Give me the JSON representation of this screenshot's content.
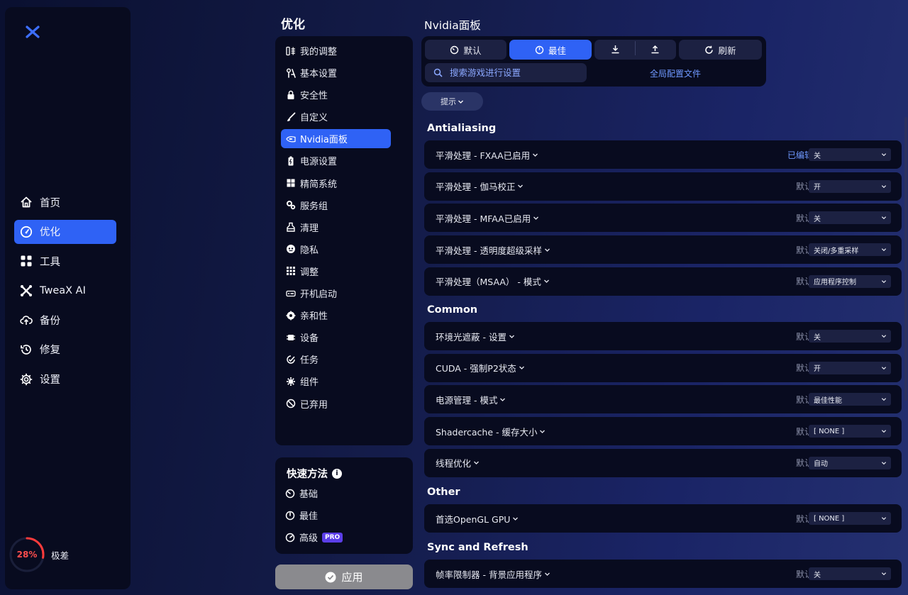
{
  "nav": {
    "items": [
      {
        "label": "首页",
        "icon": "home-icon",
        "active": false
      },
      {
        "label": "优化",
        "icon": "gauge-icon",
        "active": true
      },
      {
        "label": "工具",
        "icon": "grid-icon",
        "active": false
      },
      {
        "label": "TweaX AI",
        "icon": "ai-icon",
        "active": false
      },
      {
        "label": "备份",
        "icon": "cloud-upload-icon",
        "active": false
      },
      {
        "label": "修复",
        "icon": "history-icon",
        "active": false
      },
      {
        "label": "设置",
        "icon": "gear-icon",
        "active": false
      }
    ]
  },
  "performance": {
    "value": 28,
    "text": "28%",
    "label": "极差",
    "color": "#ff4d4d"
  },
  "section": {
    "title": "优化"
  },
  "menu": {
    "items": [
      {
        "label": "我的调整",
        "icon": "my-tweaks-icon"
      },
      {
        "label": "基本设置",
        "icon": "basic-settings-icon"
      },
      {
        "label": "安全性",
        "icon": "lock-icon"
      },
      {
        "label": "自定义",
        "icon": "brush-icon"
      },
      {
        "label": "Nvidia面板",
        "icon": "nvidia-icon",
        "active": true
      },
      {
        "label": "电源设置",
        "icon": "battery-icon"
      },
      {
        "label": "精简系统",
        "icon": "windows-icon"
      },
      {
        "label": "服务组",
        "icon": "services-icon"
      },
      {
        "label": "清理",
        "icon": "clean-icon"
      },
      {
        "label": "隐私",
        "icon": "privacy-icon"
      },
      {
        "label": "调整",
        "icon": "apps-grid-icon"
      },
      {
        "label": "开机启动",
        "icon": "startup-icon"
      },
      {
        "label": "亲和性",
        "icon": "cpu-icon"
      },
      {
        "label": "设备",
        "icon": "chip-icon"
      },
      {
        "label": "任务",
        "icon": "task-icon"
      },
      {
        "label": "组件",
        "icon": "component-icon"
      },
      {
        "label": "已弃用",
        "icon": "ban-icon"
      }
    ]
  },
  "quick": {
    "title": "快速方法",
    "items": [
      {
        "label": "基础",
        "icon": "speed-basic-icon"
      },
      {
        "label": "最佳",
        "icon": "speed-best-icon"
      },
      {
        "label": "高级",
        "icon": "speed-advanced-icon",
        "badge": "PRO"
      }
    ]
  },
  "apply": {
    "label": "应用"
  },
  "panel": {
    "title": "Nvidia面板",
    "toolbar": {
      "default_label": "默认",
      "best_label": "最佳",
      "refresh_label": "刷新",
      "search_placeholder": "搜索游戏进行设置",
      "global_profile": "全局配置文件"
    },
    "hint_label": "提示",
    "groups": [
      {
        "title": "Antialiasing",
        "rows": [
          {
            "label": "平滑处理 - FXAA已启用",
            "status": "已编辑",
            "edited": true,
            "value": "关"
          },
          {
            "label": "平滑处理 - 伽马校正",
            "status": "默认",
            "value": "开"
          },
          {
            "label": "平滑处理 - MFAA已启用",
            "status": "默认",
            "value": "关"
          },
          {
            "label": "平滑处理 - 透明度超级采样",
            "status": "默认",
            "value": "关闭/多重采样"
          },
          {
            "label": "平滑处理（MSAA） - 模式",
            "status": "默认",
            "value": "应用程序控制"
          }
        ]
      },
      {
        "title": "Common",
        "rows": [
          {
            "label": "环境光遮蔽 - 设置",
            "status": "默认",
            "value": "关"
          },
          {
            "label": "CUDA - 强制P2状态",
            "status": "默认",
            "value": "开"
          },
          {
            "label": "电源管理 - 模式",
            "status": "默认",
            "value": "最佳性能"
          },
          {
            "label": "Shadercache - 缓存大小",
            "status": "默认",
            "value": "[ NONE ]"
          },
          {
            "label": "线程优化",
            "status": "默认",
            "value": "自动"
          }
        ]
      },
      {
        "title": "Other",
        "rows": [
          {
            "label": "首选OpenGL GPU",
            "status": "默认",
            "value": "[ NONE ]"
          }
        ]
      },
      {
        "title": "Sync and Refresh",
        "rows": [
          {
            "label": "帧率限制器 - 背景应用程序",
            "status": "默认",
            "value": "关"
          }
        ]
      }
    ]
  },
  "colors": {
    "accent": "#2f62f5",
    "edited": "#6f98ff",
    "card": "#080b1f",
    "danger": "#ff4d4d"
  }
}
